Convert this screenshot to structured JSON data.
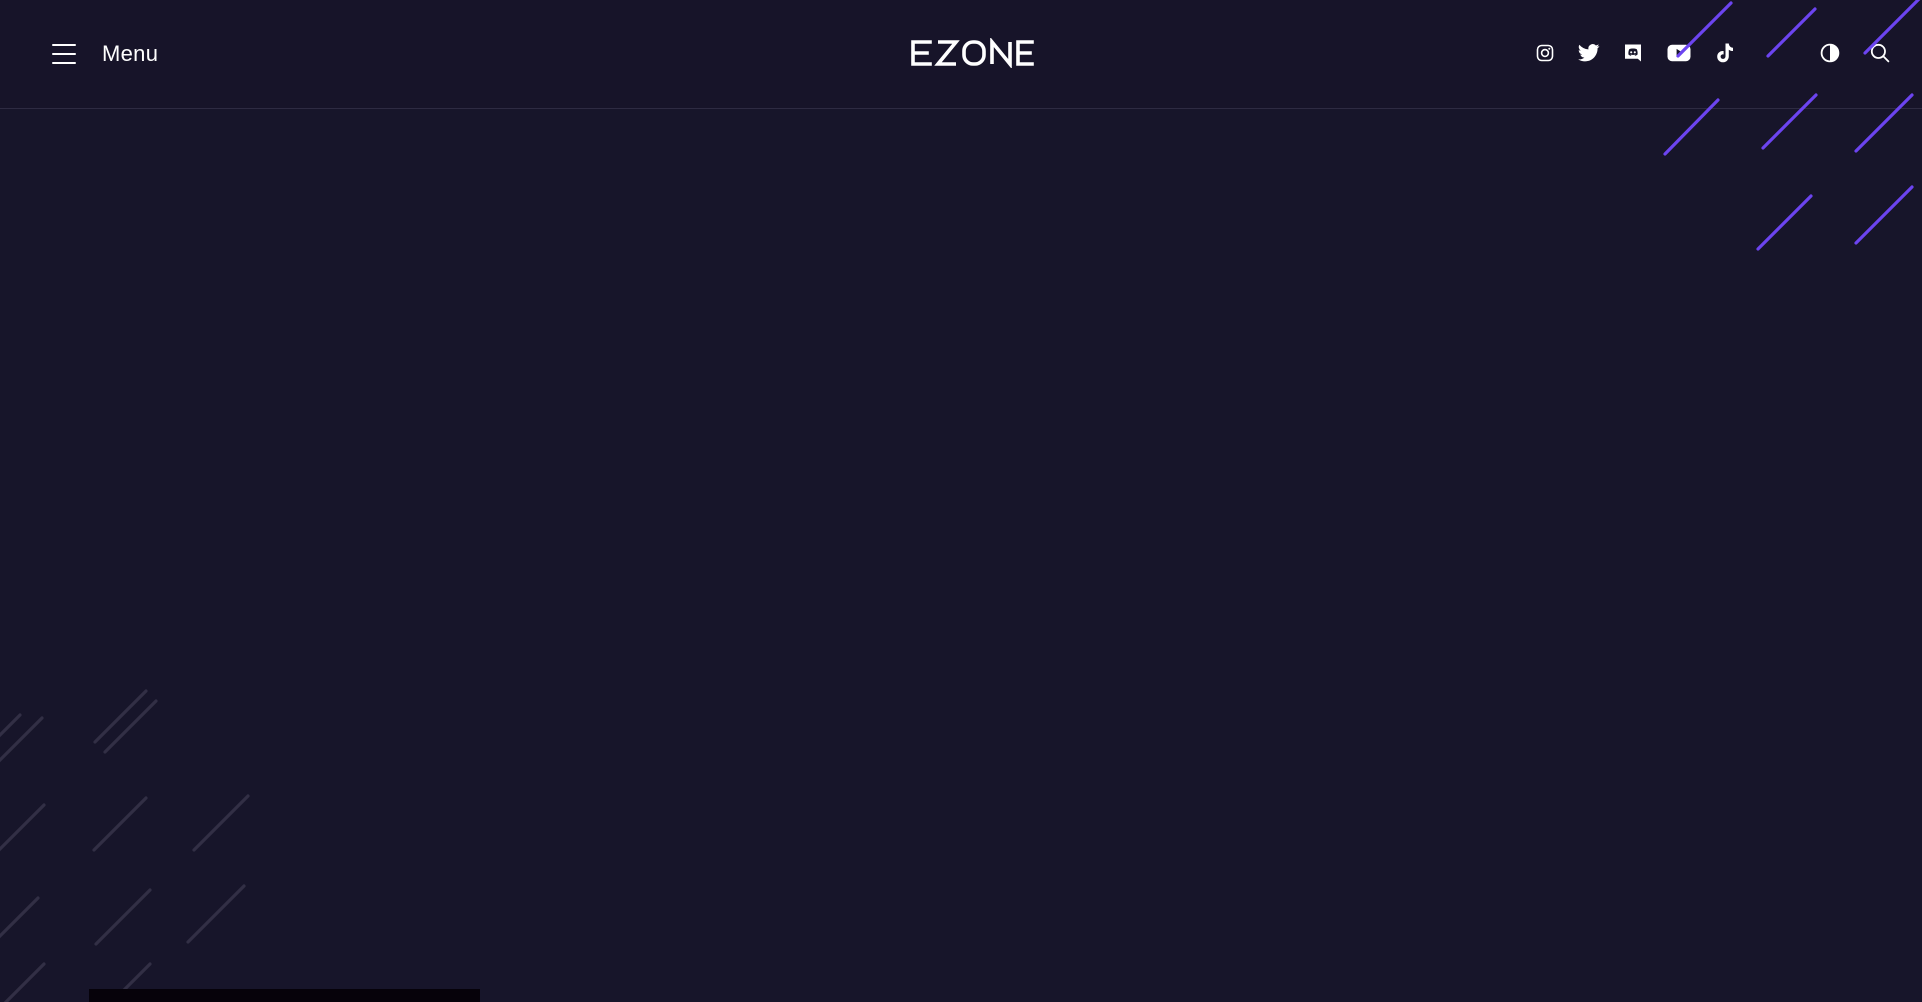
{
  "header": {
    "menu_label": "Menu",
    "logo_text": "EZONE"
  },
  "social_icons": [
    "instagram-icon",
    "twitter-icon",
    "discord-icon",
    "youtube-icon",
    "tiktok-icon"
  ],
  "tools": [
    "theme-toggle-icon",
    "search-icon"
  ],
  "colors": {
    "background": "#17152a",
    "header_border": "#2e2b42",
    "accent": "#6c44f0",
    "pattern_muted": "#322f45",
    "text": "#ffffff"
  }
}
